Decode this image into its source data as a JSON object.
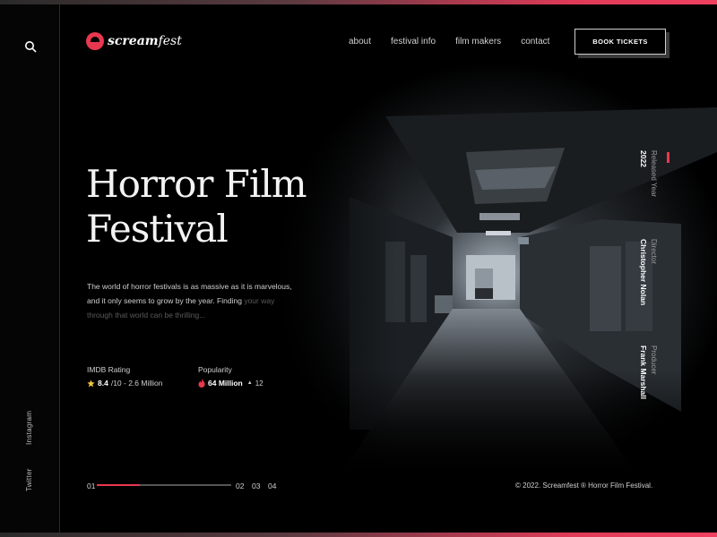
{
  "brand": {
    "logo_prefix": "scream",
    "logo_suffix": "fest"
  },
  "nav": {
    "items": [
      "about",
      "festival info",
      "film makers",
      "contact"
    ],
    "cta": "BOOK TICKETS"
  },
  "social": {
    "instagram": "Instagram",
    "twitter": "Twitter"
  },
  "hero": {
    "title_line1": "Horror Film",
    "title_line2": "Festival",
    "description_main": "The world of horror festivals is as massive as it is marvelous, and it only seems to grow by the year. Finding",
    "description_fade": "your way through that world can be thrilling..."
  },
  "stats": {
    "imdb": {
      "label": "IMDB Rating",
      "score": "8.4",
      "detail": "/10 - 2.6 Million"
    },
    "popularity": {
      "label": "Popularity",
      "value": "64 Million",
      "change": "12"
    }
  },
  "meta": {
    "released": {
      "label": "Released Year",
      "value": "2022"
    },
    "director": {
      "label": "Director",
      "value": "Christopher Nolan"
    },
    "producer": {
      "label": "Producer",
      "value": "Frank Marshall"
    }
  },
  "pager": {
    "current": "01",
    "pages": [
      "02",
      "03",
      "04"
    ],
    "progress": 0.32
  },
  "footer": {
    "copyright": "© 2022. Screamfest ® Horror Film Festival."
  },
  "colors": {
    "accent": "#e8384f",
    "background": "#000000"
  }
}
